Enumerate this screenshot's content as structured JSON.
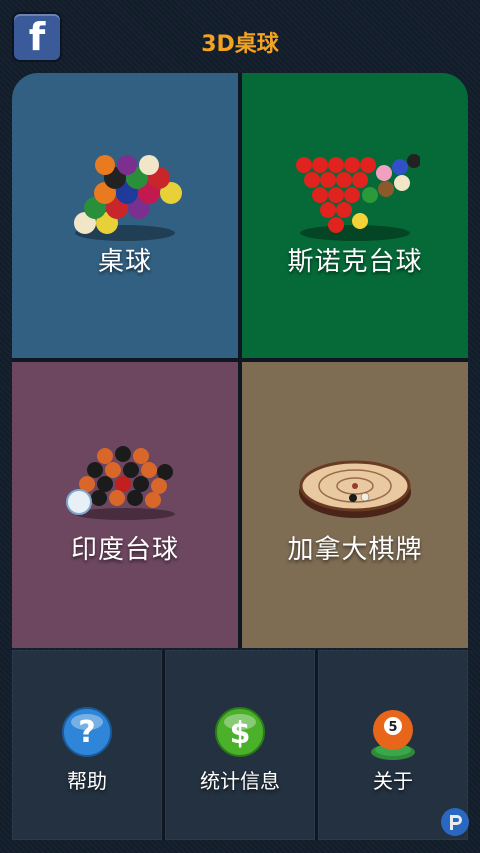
{
  "header": {
    "title": "3D桌球",
    "facebook_glyph": "f"
  },
  "tiles": [
    {
      "label": "桌球",
      "icon": "pool-balls-rack-icon",
      "color": "#326082"
    },
    {
      "label": "斯诺克台球",
      "icon": "snooker-balls-rack-icon",
      "color": "#056a38"
    },
    {
      "label": "印度台球",
      "icon": "carrom-pieces-icon",
      "color": "#6d465f"
    },
    {
      "label": "加拿大棋牌",
      "icon": "crokinole-board-icon",
      "color": "#7e6c53"
    }
  ],
  "bottom_buttons": [
    {
      "label": "帮助",
      "icon": "help-question-icon",
      "glyph": "?"
    },
    {
      "label": "统计信息",
      "icon": "dollar-stats-icon",
      "glyph": "$"
    },
    {
      "label": "关于",
      "icon": "ball-five-icon",
      "glyph": "5"
    }
  ],
  "colors": {
    "accent": "#f3a321",
    "background": "#121c2a"
  }
}
